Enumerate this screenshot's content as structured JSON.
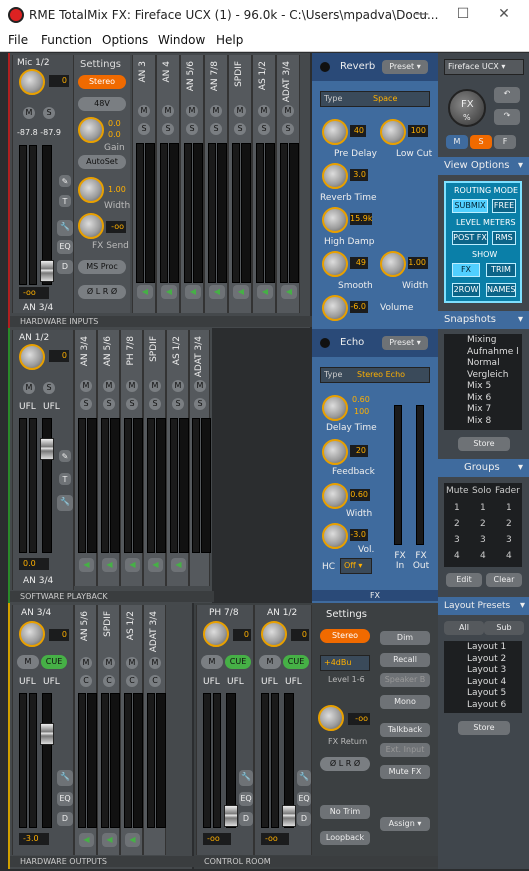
{
  "window": {
    "title": "RME TotalMix FX: Fireface UCX (1) - 96.0k - C:\\Users\\mpadva\\Docu..."
  },
  "menu": [
    "File",
    "Function",
    "Options",
    "Window",
    "Help"
  ],
  "hw_inputs": {
    "section": "HARDWARE INPUTS",
    "selected_name": "Mic 1/2",
    "settings_label": "Settings",
    "stereo": "Stereo",
    "v48": "48V",
    "gain_top": "0.0",
    "gain_bottom": "0.0",
    "gain_label": "Gain",
    "autoset": "AutoSet",
    "width_val": "1.00",
    "width_label": "Width",
    "fxsend_val": "-oo",
    "fxsend_label": "FX Send",
    "msproc": "MS Proc",
    "phase": "Ø L   R Ø",
    "levels": "-87.8 -87.9",
    "fader_val": "-oo",
    "bottom_name": "AN 3/4",
    "pan_val": "0",
    "channels": [
      "AN 3",
      "AN 4",
      "AN 5/6",
      "AN 7/8",
      "SPDIF",
      "AS 1/2",
      "ADAT 3/4"
    ]
  },
  "sw_playback": {
    "section": "SOFTWARE PLAYBACK",
    "selected_name": "AN 1/2",
    "pan_val": "0",
    "ufl1": "UFL",
    "ufl2": "UFL",
    "fader_val": "0.0",
    "bottom_name": "AN 3/4",
    "channels": [
      "AN 3/4",
      "AN 5/6",
      "PH 7/8",
      "SPDIF",
      "AS 1/2",
      "ADAT 3/4"
    ]
  },
  "hw_outputs": {
    "section": "HARDWARE OUTPUTS",
    "selected_name": "AN 3/4",
    "pan_val": "0",
    "ufl1": "UFL",
    "ufl2": "UFL",
    "fader_val": "-3.0",
    "channels": [
      "AN 5/6",
      "SPDIF",
      "AS 1/2",
      "ADAT 3/4"
    ]
  },
  "control_room": {
    "section": "CONTROL ROOM",
    "ch1": {
      "name": "PH 7/8",
      "pan": "0",
      "fader": "-oo"
    },
    "ch2": {
      "name": "AN 1/2",
      "pan": "0",
      "fader": "-oo"
    },
    "settings": "Settings",
    "stereo": "Stereo",
    "level": "+4dBu",
    "level_label": "Level 1-6",
    "fxret_val": "-oo",
    "fxret_label": "FX Return",
    "phase": "Ø L   R Ø",
    "notrim": "No Trim",
    "loopback": "Loopback",
    "dim": "Dim",
    "recall": "Recall",
    "speakerb": "Speaker B",
    "mono": "Mono",
    "talkback": "Talkback",
    "extinput": "Ext. Input",
    "mutefx": "Mute FX",
    "assign": "Assign ▾",
    "ufl": "UFL"
  },
  "reverb": {
    "title": "Reverb",
    "preset": "Preset ▾",
    "type_label": "Type",
    "type_val": "Space",
    "predelay_val": "40",
    "predelay_label": "Pre Delay",
    "lowcut_val": "100",
    "lowcut_label": "Low Cut",
    "revtime_val": "3.0",
    "revtime_label": "Reverb Time",
    "highdamp_val": "15.9k",
    "highdamp_label": "High Damp",
    "smooth_val": "49",
    "smooth_label": "Smooth",
    "width_val": "1.00",
    "width_label": "Width",
    "volume_val": "-6.0",
    "volume_label": "Volume"
  },
  "echo": {
    "title": "Echo",
    "preset": "Preset ▾",
    "type_label": "Type",
    "type_val": "Stereo Echo",
    "delay_val1": "0.60",
    "delay_val2": "100",
    "delay_label": "Delay Time",
    "feedback_val": "20",
    "feedback_label": "Feedback",
    "width_val": "0.60",
    "width_label": "Width",
    "vol_val": "-3.0",
    "vol_label": "Vol.",
    "hc_label": "HC",
    "hc_val": "Off ▾",
    "fxin": "FX In",
    "fxout": "FX Out",
    "fx_section": "FX"
  },
  "right": {
    "device": "Fireface UCX ▾",
    "fx_label": "FX",
    "percent": "%",
    "msf": [
      "M",
      "S",
      "F"
    ],
    "view_options": "View Options",
    "routing_mode": "ROUTING MODE",
    "submix": "SUBMIX",
    "free": "FREE",
    "level_meters": "LEVEL METERS",
    "postfx": "POST FX",
    "rms": "RMS",
    "show": "SHOW",
    "fx": "FX",
    "trim": "TRIM",
    "row2": "2ROW",
    "names": "NAMES",
    "snapshots_title": "Snapshots",
    "snapshots": [
      "Mixing",
      "Aufnahme l",
      "Normal",
      "Vergleich",
      "Mix  5",
      "Mix  6",
      "Mix  7",
      "Mix  8"
    ],
    "store": "Store",
    "groups_title": "Groups",
    "groups_headers": [
      "Mute",
      "Solo",
      "Fader"
    ],
    "groups_rows": [
      [
        "1",
        "1",
        "1"
      ],
      [
        "2",
        "2",
        "2"
      ],
      [
        "3",
        "3",
        "3"
      ],
      [
        "4",
        "4",
        "4"
      ]
    ],
    "edit": "Edit",
    "clear": "Clear",
    "layout_title": "Layout Presets",
    "all": "All",
    "sub": "Sub",
    "layouts": [
      "Layout 1",
      "Layout 2",
      "Layout 3",
      "Layout 4",
      "Layout 5",
      "Layout 6"
    ],
    "store2": "Store"
  },
  "colors": {
    "accent": "#f06a00",
    "cue": "#46b046",
    "cyan": "#51d0ff",
    "panel_blue": "#3f6b9e"
  }
}
